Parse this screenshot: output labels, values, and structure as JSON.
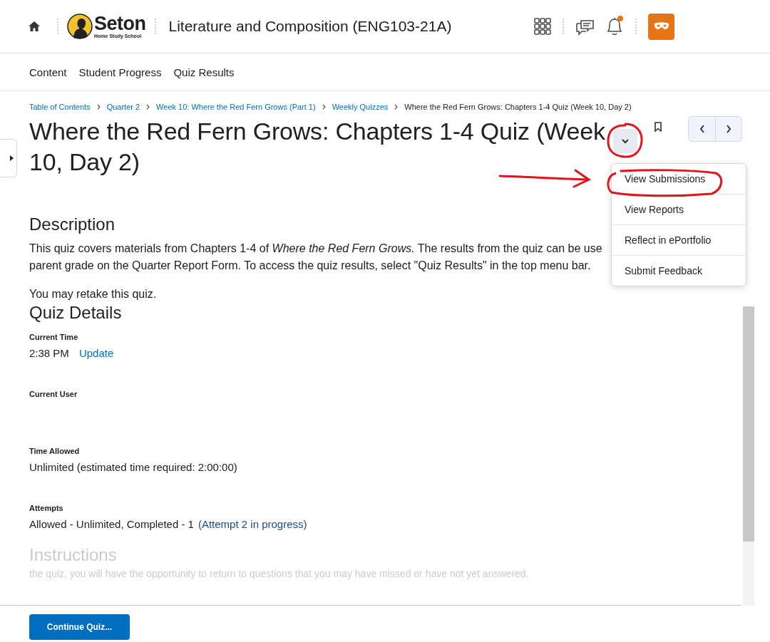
{
  "header": {
    "logo": {
      "name": "Seton",
      "tagline": "Home Study School"
    },
    "course_title": "Literature and Composition (ENG103-21A)",
    "notification_unread": true
  },
  "nav": [
    "Content",
    "Student Progress",
    "Quiz Results"
  ],
  "breadcrumbs": [
    {
      "label": "Table of Contents",
      "link": true
    },
    {
      "label": "Quarter 2",
      "link": true
    },
    {
      "label": "Week 10: Where the Red Fern Grows (Part 1)",
      "link": true
    },
    {
      "label": "Weekly Quizzes",
      "link": true
    },
    {
      "label": "Where the Red Fern Grows: Chapters 1-4 Quiz (Week 10, Day 2)",
      "link": false
    }
  ],
  "title": "Where the Red Fern Grows: Chapters 1-4 Quiz (Week 10, Day 2)",
  "menu": {
    "expanded": true,
    "items": [
      "View Submissions",
      "View Reports",
      "Reflect in ePortfolio",
      "Submit Feedback"
    ]
  },
  "description": {
    "heading": "Description",
    "text": "This quiz covers materials from Chapters 1-4 of *Where the Red Fern Grows.*  The results from the quiz can be use",
    "text2": "parent grade on the Quarter Report Form.  To access the quiz results, select \"Quiz Results\" in the top menu bar.",
    "note": "You may retake this quiz."
  },
  "details": {
    "heading": "Quiz Details",
    "fields": [
      {
        "label": "Current Time",
        "value": "2:38 PM",
        "link": "Update"
      },
      {
        "label": "Current User"
      },
      {
        "label": "Time Allowed",
        "value": "Unlimited (estimated time required: 2:00:00)"
      },
      {
        "label": "Attempts",
        "value": "Allowed - Unlimited, Completed - 1",
        "link": "(Attempt 2 in progress)"
      }
    ]
  },
  "instructions": {
    "heading": "Instructions",
    "text": "the quiz, you will have the opportunity to return to questions that you may have missed or have not yet answered."
  },
  "footer": {
    "button": "Continue Quiz..."
  }
}
